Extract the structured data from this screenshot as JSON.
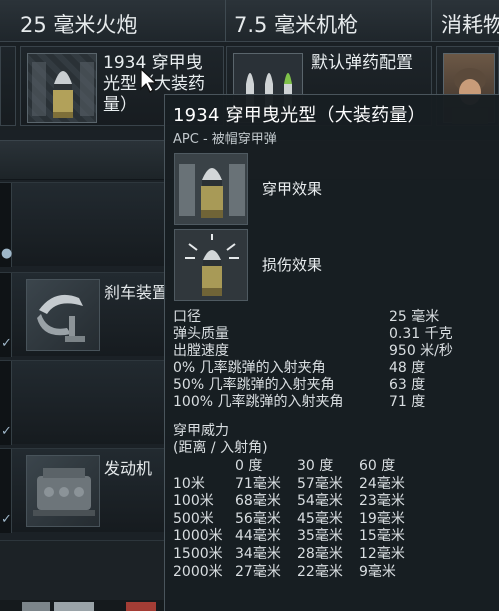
{
  "tabs": [
    {
      "label": "25 毫米火炮"
    },
    {
      "label": "7.5 毫米机枪"
    },
    {
      "label": "消耗物"
    }
  ],
  "slots": [
    {
      "label": "1934 穿甲曳光型（大装药量）",
      "icon": "shell-icon"
    },
    {
      "label": "默认弹药配置",
      "icon": "ammo-belt-icon"
    },
    {
      "label": "",
      "icon": "crew-portrait"
    }
  ],
  "modules": [
    {
      "label": "",
      "icon": "module-icon"
    },
    {
      "label": "刹车装置",
      "icon": "brake-icon"
    },
    {
      "label": "",
      "icon": "module-icon"
    },
    {
      "label": "发动机",
      "icon": "engine-icon"
    }
  ],
  "tooltip": {
    "title": "1934 穿甲曳光型（大装药量）",
    "subtitle": "APC - 被帽穿甲弹",
    "effects": [
      {
        "label": "穿甲效果",
        "icon": "penetration-effect-icon"
      },
      {
        "label": "损伤效果",
        "icon": "damage-effect-icon"
      }
    ],
    "stats": [
      {
        "label": "口径",
        "value": "25 毫米"
      },
      {
        "label": "弹头质量",
        "value": "0.31 千克"
      },
      {
        "label": "出膛速度",
        "value": "950 米/秒"
      },
      {
        "label": "0% 几率跳弹的入射夹角",
        "value": "48 度"
      },
      {
        "label": "50% 几率跳弹的入射夹角",
        "value": "63 度"
      },
      {
        "label": "100% 几率跳弹的入射夹角",
        "value": "71 度"
      }
    ],
    "penetration": {
      "title": "穿甲威力",
      "subtitle": "(距离 / 入射角)",
      "headers": [
        "",
        "0 度",
        "30 度",
        "60 度"
      ],
      "rows": [
        [
          "10米",
          "71毫米",
          "57毫米",
          "24毫米"
        ],
        [
          "100米",
          "68毫米",
          "54毫米",
          "23毫米"
        ],
        [
          "500米",
          "56毫米",
          "45毫米",
          "19毫米"
        ],
        [
          "1000米",
          "44毫米",
          "35毫米",
          "15毫米"
        ],
        [
          "1500米",
          "34毫米",
          "28毫米",
          "12毫米"
        ],
        [
          "2000米",
          "27毫米",
          "22毫米",
          "9毫米"
        ]
      ]
    }
  },
  "colors": {
    "background": "#1b2126",
    "tooltip_bg": "#181e22",
    "text": "#d9dee1",
    "title": "#ffffff"
  }
}
